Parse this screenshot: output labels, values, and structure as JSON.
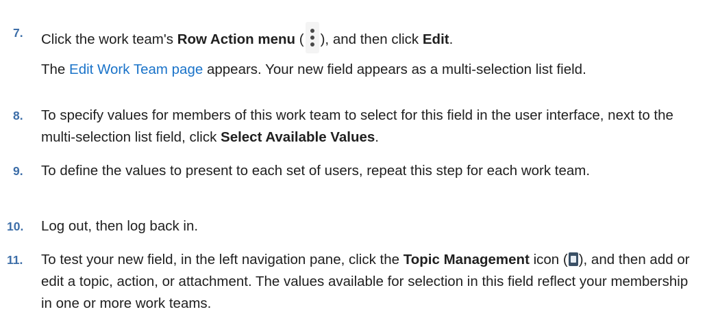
{
  "steps": [
    {
      "number": "7.",
      "text_before": "Click the work team's ",
      "bold1": "Row Action menu",
      "text_mid1": " (",
      "icon": "vertical-ellipsis-icon",
      "text_mid2": "), and then click ",
      "bold2": "Edit",
      "text_end": ".",
      "sub_before": "The ",
      "sub_link": "Edit Work Team page",
      "sub_after": " appears. Your new field appears as a multi-selection list field."
    },
    {
      "number": "8.",
      "text_before": "To specify values for members of this work team to select for this field in the user interface, next to the multi-selection list field, click ",
      "bold1": "Select Available Values",
      "text_end": "."
    },
    {
      "number": "9.",
      "text": "To define the values to present to each set of users, repeat this step for each work team."
    },
    {
      "number": "10.",
      "text": "Log out, then log back in."
    },
    {
      "number": "11.",
      "text_before": "To test your new field, in the left navigation pane, click the ",
      "bold1": "Topic Management",
      "text_mid1": " icon (",
      "icon": "topic-management-icon",
      "text_mid2": "), and then add or edit a topic, action, or attachment. The values available for selection in this field reflect your membership in one or more work teams."
    }
  ],
  "colors": {
    "step_number": "#3d6ea8",
    "link": "#1a73c9",
    "text": "#202020"
  }
}
